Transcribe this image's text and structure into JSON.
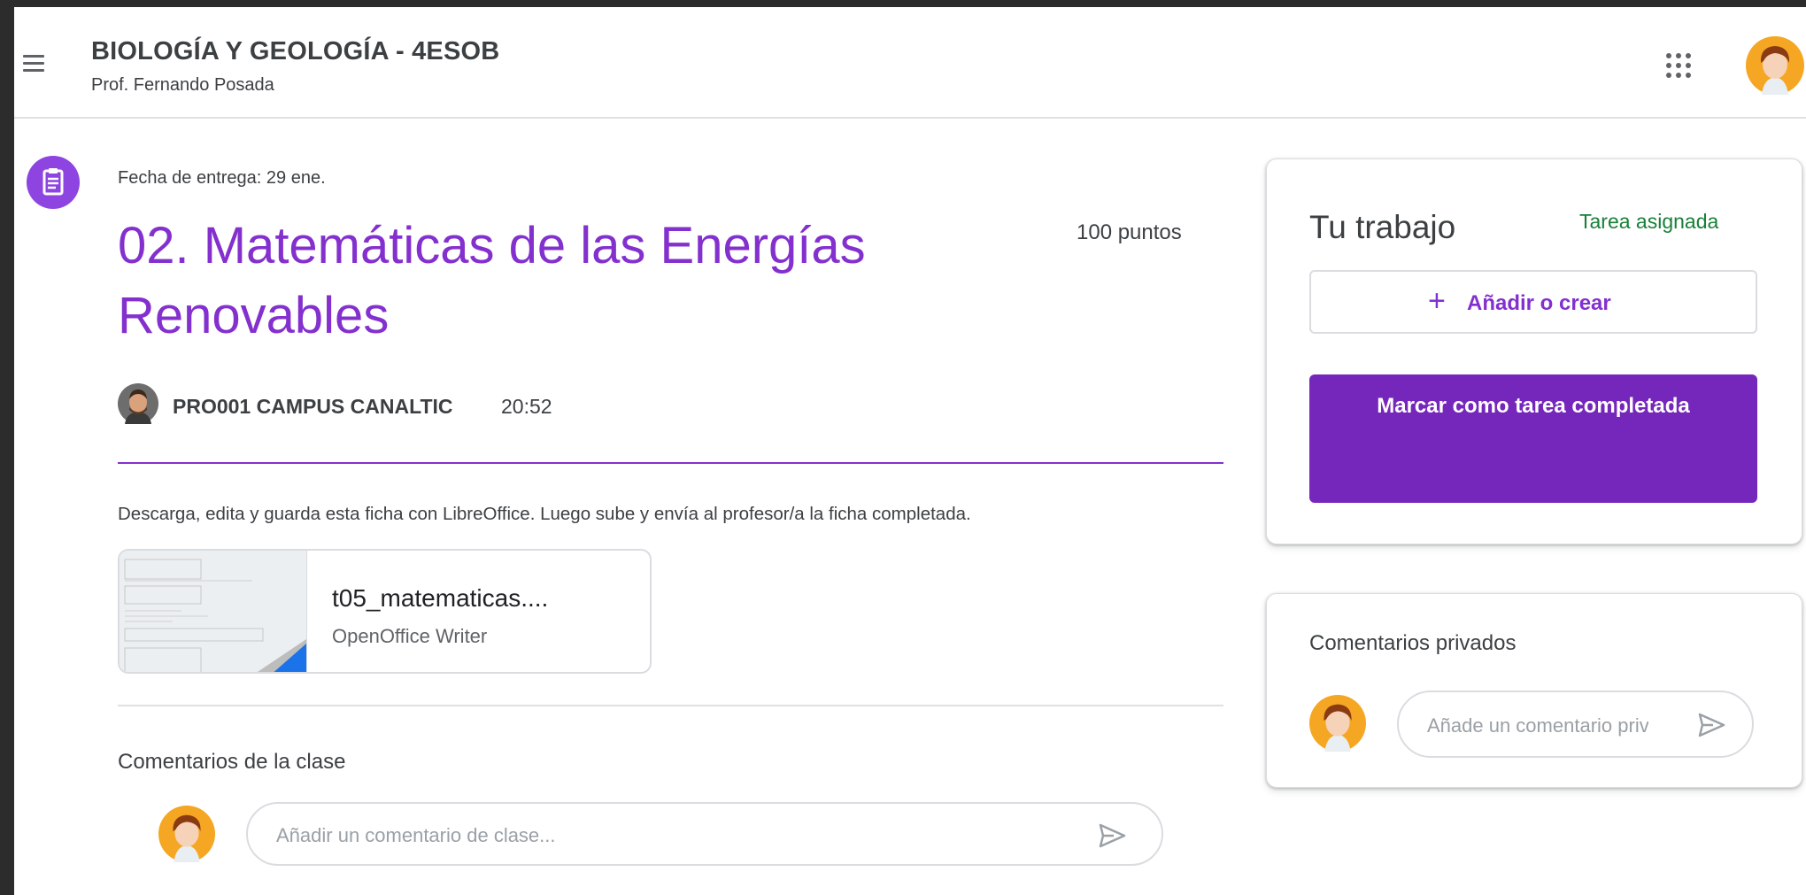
{
  "header": {
    "class_title": "BIOLOGÍA Y GEOLOGÍA - 4ESOB",
    "teacher": "Prof. Fernando Posada",
    "menu_icon": "hamburger-menu-icon",
    "apps_icon": "apps-grid-icon"
  },
  "assignment": {
    "due_date": "Fecha de entrega: 29 ene.",
    "title": "02. Matemáticas de las Energías Renovables",
    "points": "100 puntos",
    "author": "PRO001 CAMPUS CANALTIC",
    "posted_time": "20:52",
    "description": "Descarga, edita y guarda esta ficha con LibreOffice. Luego sube y envía al profesor/a la ficha completada.",
    "attachment": {
      "name": "t05_matematicas....",
      "type": "OpenOffice Writer"
    }
  },
  "class_comments": {
    "title": "Comentarios de la clase",
    "placeholder": "Añadir un comentario de clase..."
  },
  "your_work": {
    "title": "Tu trabajo",
    "status": "Tarea asignada",
    "add_label": "Añadir o crear",
    "complete_label": "Marcar como tarea completada"
  },
  "private_comments": {
    "title": "Comentarios privados",
    "placeholder": "Añade un comentario privado..."
  },
  "colors": {
    "accent_purple": "#8430ce",
    "button_purple": "#7627bb",
    "status_green": "#188038"
  }
}
